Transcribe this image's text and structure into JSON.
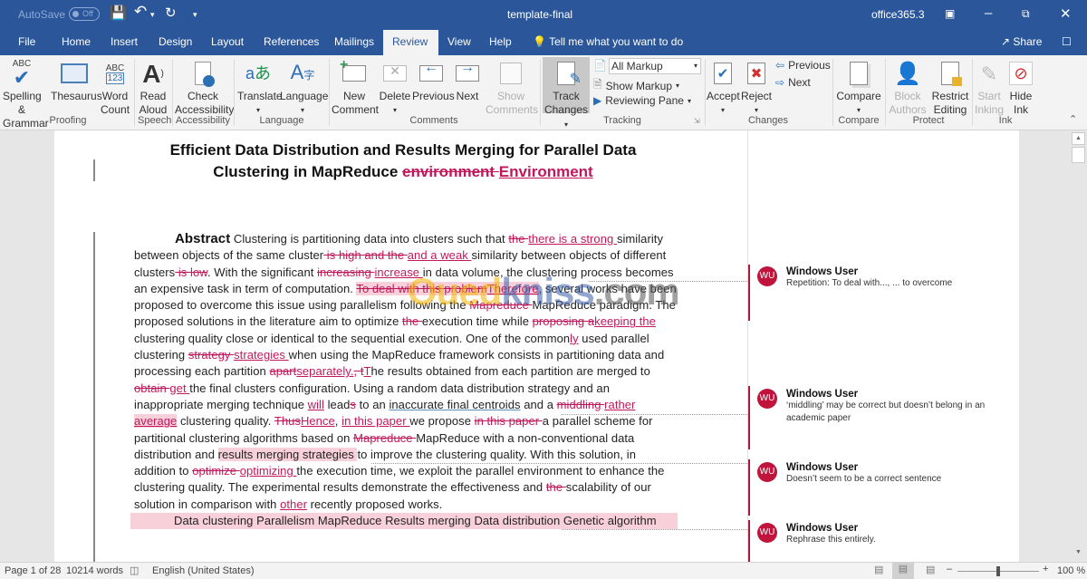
{
  "titlebar": {
    "autosave_label": "AutoSave",
    "autosave_state": "Off",
    "document_title": "template-final",
    "account": "office365.3"
  },
  "tabs": [
    "File",
    "Home",
    "Insert",
    "Design",
    "Layout",
    "References",
    "Mailings",
    "Review",
    "View",
    "Help"
  ],
  "active_tab": "Review",
  "tell_me": "Tell me what you want to do",
  "share_label": "Share",
  "ribbon": {
    "proofing": {
      "spelling": "Spelling &",
      "spelling2": "Grammar",
      "thesaurus": "Thesaurus",
      "word_count": "Word",
      "word_count2": "Count",
      "group": "Proofing"
    },
    "speech": {
      "read_aloud": "Read",
      "read_aloud2": "Aloud",
      "group": "Speech"
    },
    "accessibility": {
      "check": "Check",
      "check2": "Accessibility",
      "group": "Accessibility"
    },
    "language": {
      "translate": "Translate",
      "language": "Language",
      "group": "Language"
    },
    "comments": {
      "new": "New",
      "new2": "Comment",
      "delete": "Delete",
      "previous": "Previous",
      "next": "Next",
      "show": "Show",
      "show2": "Comments",
      "group": "Comments"
    },
    "tracking": {
      "track": "Track",
      "track2": "Changes",
      "markup_select": "All Markup",
      "show_markup": "Show Markup",
      "reviewing_pane": "Reviewing Pane",
      "group": "Tracking"
    },
    "changes": {
      "accept": "Accept",
      "reject": "Reject",
      "previous": "Previous",
      "next": "Next",
      "group": "Changes"
    },
    "compare": {
      "compare": "Compare",
      "group": "Compare"
    },
    "protect": {
      "block": "Block",
      "block2": "Authors",
      "restrict": "Restrict",
      "restrict2": "Editing",
      "group": "Protect"
    },
    "ink": {
      "start": "Start",
      "start2": "Inking",
      "hide": "Hide",
      "hide2": "Ink",
      "group": "Ink"
    }
  },
  "document": {
    "title_line1": "Efficient Data Distribution and Results Merging for Parallel Data",
    "title_line2_pre": "Clustering in MapReduce ",
    "title_line2_del": "environment ",
    "title_line2_ins": "Environment ",
    "abstract_heading": "Abstract",
    "keywords": "Data clustering Parallelism MapReduce Results merging Data distribution Genetic algorithm",
    "segments": [
      {
        "t": "n",
        "s": " Clustering is partitioning data into clusters such that "
      },
      {
        "t": "d",
        "s": "the "
      },
      {
        "t": "i",
        "s": "there is a strong "
      },
      {
        "t": "n",
        "s": " similarity between objects of the same cluster"
      },
      {
        "t": "d",
        "s": " is high and the "
      },
      {
        "t": "i",
        "s": "  and a weak "
      },
      {
        "t": "n",
        "s": "similarity between objects of different clusters"
      },
      {
        "t": "d",
        "s": " is low"
      },
      {
        "t": "n",
        "s": ". With the significant "
      },
      {
        "t": "d",
        "s": "increasing "
      },
      {
        "t": "i",
        "s": "increase "
      },
      {
        "t": "n",
        "s": "in data volume, the clustering process becomes an expensive task in term of computation. "
      },
      {
        "t": "dh",
        "s": "To deal with this problem"
      },
      {
        "t": "ih",
        "s": "Therefore"
      },
      {
        "t": "n",
        "s": ", several works have been proposed to overcome this issue using parallelism following the "
      },
      {
        "t": "d",
        "s": "Mapreduce "
      },
      {
        "t": "n",
        "s": "MapReduce paradigm. The proposed solutions in the literature aim to optimize "
      },
      {
        "t": "d",
        "s": "the "
      },
      {
        "t": "n",
        "s": "execution time while "
      },
      {
        "t": "d",
        "s": "proposing a"
      },
      {
        "t": "i",
        "s": "keeping the"
      },
      {
        "t": "n",
        "s": " clustering quality close or identical to the sequential execution. One of the common"
      },
      {
        "t": "i",
        "s": "ly"
      },
      {
        "t": "n",
        "s": " used parallel clustering "
      },
      {
        "t": "d",
        "s": "strategy "
      },
      {
        "t": "i",
        "s": "strategies "
      },
      {
        "t": "n",
        "s": "when using the MapReduce framework consists in partitioning data and processing each partition "
      },
      {
        "t": "d",
        "s": "apart"
      },
      {
        "t": "i",
        "s": "separately."
      },
      {
        "t": "d",
        "s": ", t"
      },
      {
        "t": "i",
        "s": "T"
      },
      {
        "t": "n",
        "s": "he results obtained from each partition are merged to "
      },
      {
        "t": "d",
        "s": "obtain "
      },
      {
        "t": "i",
        "s": "get "
      },
      {
        "t": "n",
        "s": "the final clusters configuration. Using a random data distribution strategy and an inappropriate merging technique "
      },
      {
        "t": "i",
        "s": "will"
      },
      {
        "t": "n",
        "s": " lead"
      },
      {
        "t": "d",
        "s": "s"
      },
      {
        "t": "n",
        "s": " to an "
      },
      {
        "t": "u",
        "s": "inaccurate final centroids"
      },
      {
        "t": "n",
        "s": " and a "
      },
      {
        "t": "d",
        "s": "middling "
      },
      {
        "t": "i",
        "s": "rather "
      },
      {
        "t": "ih",
        "s": "average"
      },
      {
        "t": "n",
        "s": " clustering quality. "
      },
      {
        "t": "d",
        "s": "Thus"
      },
      {
        "t": "i",
        "s": "Hence"
      },
      {
        "t": "n",
        "s": ", "
      },
      {
        "t": "i",
        "s": "in this paper "
      },
      {
        "t": "n",
        "s": "we propose "
      },
      {
        "t": "d",
        "s": "in this paper "
      },
      {
        "t": "n",
        "s": "a parallel scheme for partitional clustering algorithms based on "
      },
      {
        "t": "d",
        "s": "Mapreduce "
      },
      {
        "t": "n",
        "s": "MapReduce with a non-conventional data distribution and "
      },
      {
        "t": "h",
        "s": "results merging strategies "
      },
      {
        "t": "n",
        "s": "to improve the clustering quality. With this solution, in addition to "
      },
      {
        "t": "d",
        "s": "optimize "
      },
      {
        "t": "i",
        "s": "optimizing "
      },
      {
        "t": "n",
        "s": "the execution time, we exploit the parallel environment to enhance the clustering quality. The experimental results demonstrate the effectiveness and "
      },
      {
        "t": "d",
        "s": "the "
      },
      {
        "t": "n",
        "s": "scalability of our solution in comparison with "
      },
      {
        "t": "i",
        "s": "other"
      },
      {
        "t": "n",
        "s": " recently proposed works."
      }
    ]
  },
  "comments": [
    {
      "initials": "WU",
      "author": "Windows User",
      "text": "Repetition: To deal with..., ... to overcome"
    },
    {
      "initials": "WU",
      "author": "Windows User",
      "text": "‘middling’ may be correct but doesn’t belong in an academic paper"
    },
    {
      "initials": "WU",
      "author": "Windows User",
      "text": "Doesn’t seem to be a correct sentence"
    },
    {
      "initials": "WU",
      "author": "Windows User",
      "text": "Rephrase this entirely."
    }
  ],
  "watermark": "Ouedkniss.com",
  "status": {
    "page": "Page 1 of 28",
    "words": "10214 words",
    "language": "English (United States)",
    "zoom": "100 %",
    "zoom_fraction": 0.5
  },
  "colors": {
    "brand": "#2b579a",
    "revision": "#c2185b",
    "comment_avatar": "#c0143c"
  }
}
